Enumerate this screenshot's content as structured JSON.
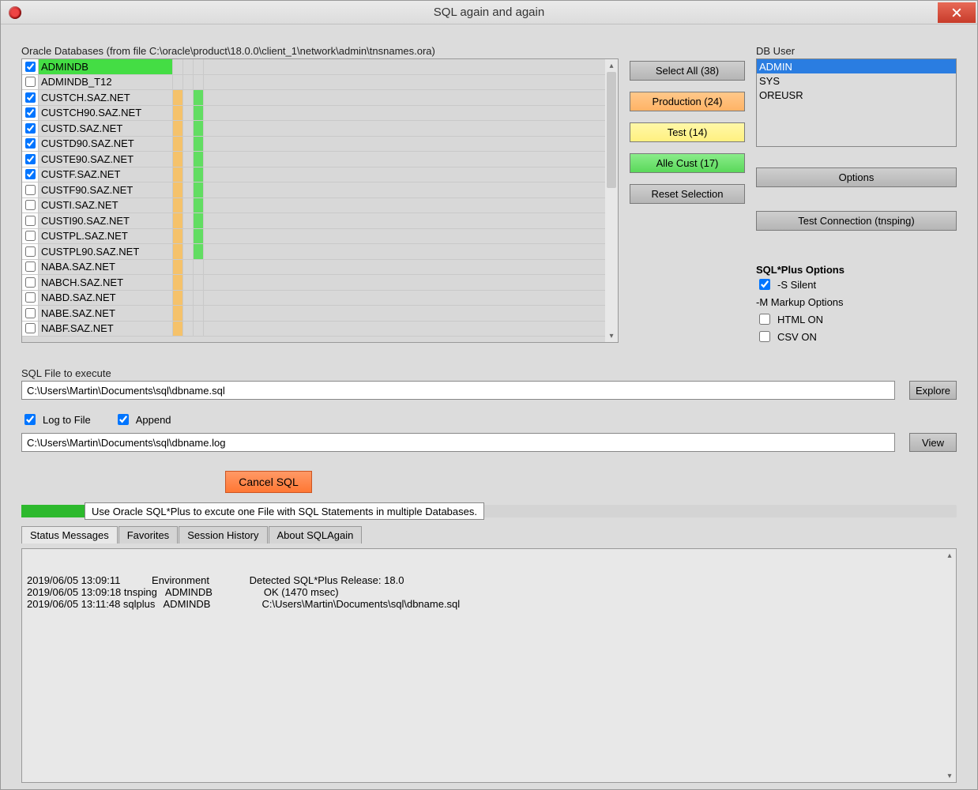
{
  "window": {
    "title": "SQL again and again"
  },
  "labels": {
    "databases": "Oracle Databases (from file C:\\oracle\\product\\18.0.0\\client_1\\network\\admin\\tnsnames.ora)",
    "dbuser": "DB User",
    "sqlfile": "SQL File to execute",
    "logtofile": "Log to File",
    "append": "Append",
    "sqlplus_options": "SQL*Plus Options",
    "silent": "-S Silent",
    "markup": "-M Markup Options",
    "html_on": "HTML ON",
    "csv_on": "CSV ON"
  },
  "databases": [
    {
      "name": "ADMINDB",
      "checked": true,
      "name_hl": "green",
      "c1": "",
      "c2": "",
      "c3": ""
    },
    {
      "name": "ADMINDB_T12",
      "checked": false,
      "name_hl": "",
      "c1": "",
      "c2": "",
      "c3": ""
    },
    {
      "name": "CUSTCH.SAZ.NET",
      "checked": true,
      "name_hl": "",
      "c1": "orange",
      "c2": "",
      "c3": "green"
    },
    {
      "name": "CUSTCH90.SAZ.NET",
      "checked": true,
      "name_hl": "",
      "c1": "orange",
      "c2": "",
      "c3": "green"
    },
    {
      "name": "CUSTD.SAZ.NET",
      "checked": true,
      "name_hl": "",
      "c1": "orange",
      "c2": "",
      "c3": "green"
    },
    {
      "name": "CUSTD90.SAZ.NET",
      "checked": true,
      "name_hl": "",
      "c1": "orange",
      "c2": "",
      "c3": "green"
    },
    {
      "name": "CUSTE90.SAZ.NET",
      "checked": true,
      "name_hl": "",
      "c1": "orange",
      "c2": "",
      "c3": "green"
    },
    {
      "name": "CUSTF.SAZ.NET",
      "checked": true,
      "name_hl": "",
      "c1": "orange",
      "c2": "",
      "c3": "green"
    },
    {
      "name": "CUSTF90.SAZ.NET",
      "checked": false,
      "name_hl": "",
      "c1": "orange",
      "c2": "",
      "c3": "green"
    },
    {
      "name": "CUSTI.SAZ.NET",
      "checked": false,
      "name_hl": "",
      "c1": "orange",
      "c2": "",
      "c3": "green"
    },
    {
      "name": "CUSTI90.SAZ.NET",
      "checked": false,
      "name_hl": "",
      "c1": "orange",
      "c2": "",
      "c3": "green"
    },
    {
      "name": "CUSTPL.SAZ.NET",
      "checked": false,
      "name_hl": "",
      "c1": "orange",
      "c2": "",
      "c3": "green"
    },
    {
      "name": "CUSTPL90.SAZ.NET",
      "checked": false,
      "name_hl": "",
      "c1": "orange",
      "c2": "",
      "c3": "green"
    },
    {
      "name": "NABA.SAZ.NET",
      "checked": false,
      "name_hl": "",
      "c1": "orange",
      "c2": "",
      "c3": ""
    },
    {
      "name": "NABCH.SAZ.NET",
      "checked": false,
      "name_hl": "",
      "c1": "orange",
      "c2": "",
      "c3": ""
    },
    {
      "name": "NABD.SAZ.NET",
      "checked": false,
      "name_hl": "",
      "c1": "orange",
      "c2": "",
      "c3": ""
    },
    {
      "name": "NABE.SAZ.NET",
      "checked": false,
      "name_hl": "",
      "c1": "orange",
      "c2": "",
      "c3": ""
    },
    {
      "name": "NABF.SAZ.NET",
      "checked": false,
      "name_hl": "",
      "c1": "orange",
      "c2": "",
      "c3": ""
    }
  ],
  "buttons": {
    "select_all": "Select All (38)",
    "production": "Production (24)",
    "test": "Test (14)",
    "alle_cust": "Alle Cust (17)",
    "reset": "Reset Selection",
    "options": "Options",
    "test_conn": "Test Connection (tnsping)",
    "explore": "Explore",
    "view": "View",
    "cancel_sql": "Cancel SQL"
  },
  "users": [
    {
      "name": "ADMIN",
      "selected": true
    },
    {
      "name": "SYS",
      "selected": false
    },
    {
      "name": "OREUSR",
      "selected": false
    }
  ],
  "sqlplus": {
    "silent_checked": true,
    "html_checked": false,
    "csv_checked": false
  },
  "fields": {
    "sqlfile": "C:\\Users\\Martin\\Documents\\sql\\dbname.sql",
    "logfile": "C:\\Users\\Martin\\Documents\\sql\\dbname.log",
    "log_checked": true,
    "append_checked": true
  },
  "tooltip": "Use Oracle SQL*Plus to excute one File with SQL Statements in multiple Databases.",
  "tabs": [
    {
      "label": "Status Messages",
      "active": true
    },
    {
      "label": "Favorites",
      "active": false
    },
    {
      "label": "Session History",
      "active": false
    },
    {
      "label": "About SQLAgain",
      "active": false
    }
  ],
  "log_lines": [
    {
      "ts": "2019/06/05 13:09:11",
      "cmd": "",
      "tgt": "Environment",
      "msg": "Detected SQL*Plus Release: 18.0"
    },
    {
      "ts": "2019/06/05 13:09:18",
      "cmd": "tnsping",
      "tgt": "ADMINDB",
      "msg": "OK (1470 msec)"
    },
    {
      "ts": "2019/06/05 13:11:48",
      "cmd": "sqlplus",
      "tgt": "ADMINDB",
      "msg": "C:\\Users\\Martin\\Documents\\sql\\dbname.sql"
    }
  ]
}
